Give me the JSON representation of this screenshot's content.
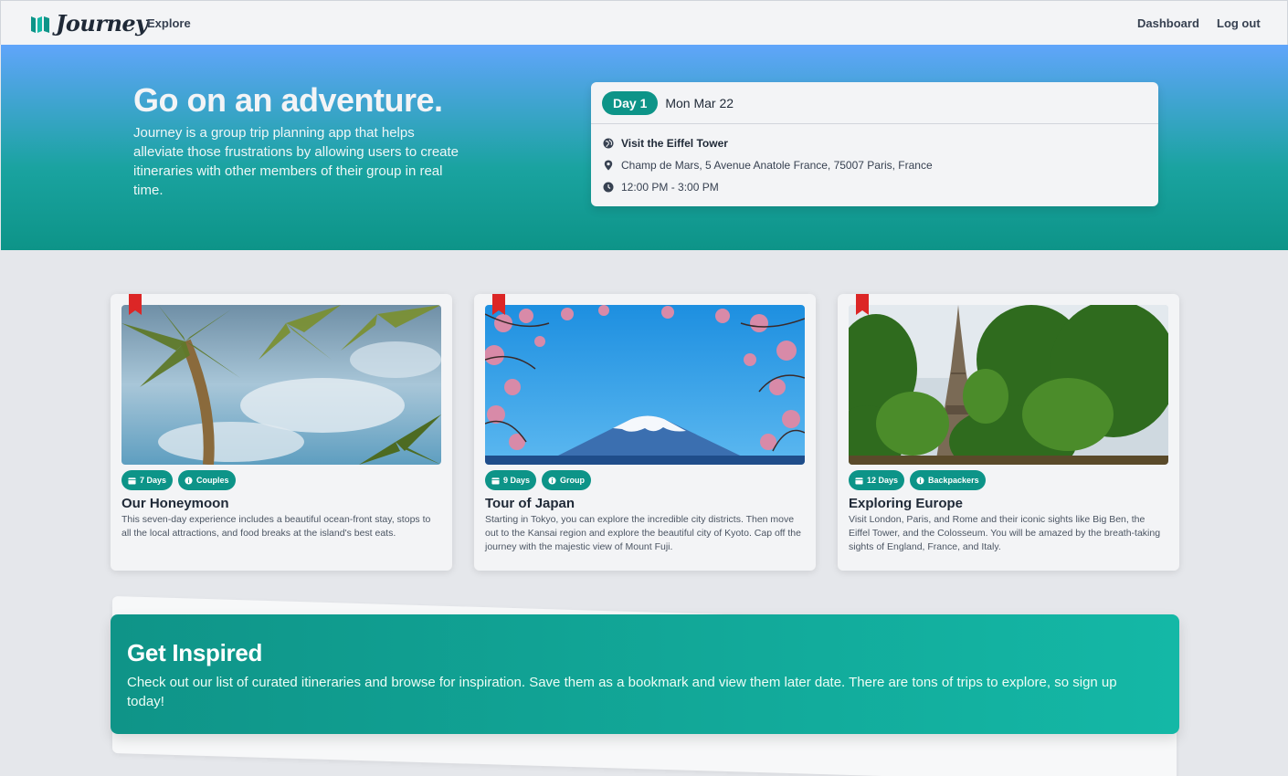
{
  "nav": {
    "brand": "Journey",
    "explore": "Explore",
    "dashboard": "Dashboard",
    "logout": "Log out"
  },
  "hero": {
    "title": "Go on an adventure.",
    "description": "Journey is a group trip planning app that helps alleviate those frustrations by allowing users to create itineraries with other members of their group in real time."
  },
  "itinerary_preview": {
    "day_badge": "Day 1",
    "date": "Mon Mar 22",
    "activity": "Visit the Eiffel Tower",
    "address": "Champ de Mars, 5 Avenue Anatole France, 75007 Paris, France",
    "time": "12:00 PM - 3:00 PM"
  },
  "trips": [
    {
      "title": "Our Honeymoon",
      "days": "7 Days",
      "category": "Couples",
      "description": "This seven-day experience includes a beautiful ocean-front stay, stops to all the local attractions, and food breaks at the island's best eats."
    },
    {
      "title": "Tour of Japan",
      "days": "9 Days",
      "category": "Group",
      "description": "Starting in Tokyo, you can explore the incredible city districts. Then move out to the Kansai region and explore the beautiful city of Kyoto. Cap off the journey with the majestic view of Mount Fuji."
    },
    {
      "title": "Exploring Europe",
      "days": "12 Days",
      "category": "Backpackers",
      "description": "Visit London, Paris, and Rome and their iconic sights like Big Ben, the Eiffel Tower, and the Colosseum. You will be amazed by the breath-taking sights of England, France, and Italy."
    }
  ],
  "inspire": {
    "title": "Get Inspired",
    "description": "Check out our list of curated itineraries and browse for inspiration. Save them as a bookmark and view them later date. There are tons of trips to explore, so sign up today!"
  },
  "colors": {
    "accent": "#0d9488",
    "bookmark": "#dc2626",
    "hero_top": "#60a5fa"
  }
}
